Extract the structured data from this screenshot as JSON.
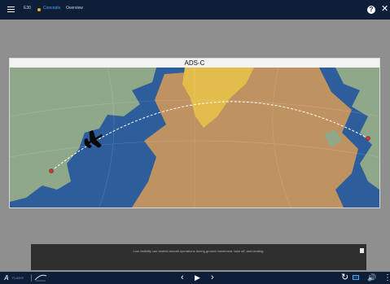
{
  "header": {
    "menu_icon": "hamburger-menu-icon",
    "crumb_code": "E30",
    "crumb_section": "Concepts",
    "crumb_page": "Overview",
    "help_glyph": "?",
    "close_glyph": "✕",
    "colors": {
      "bar": "#0f1e38",
      "accent": "#4aa7f0",
      "dot": "#f2b01e"
    }
  },
  "slide": {
    "title": "ADS-C",
    "map_icons": [
      "airplane-icon",
      "origin-point-icon",
      "destination-point-icon"
    ],
    "colors": {
      "water": "#2d5d9a",
      "land": "#8fa88a",
      "airspace": "#c7955e",
      "ice": "#e2bd4c",
      "route": "#ffffff",
      "point": "#c43b3b"
    }
  },
  "caption": {
    "text": "Low visibility can restrict aircraft operations during ground movement, take off, and landing.",
    "note_icon": "notes-icon"
  },
  "footer": {
    "logo_mark": "A",
    "logo_text": "FLIGHT",
    "prev_glyph": "‹",
    "play_glyph": "▶",
    "next_glyph": "›",
    "replay_glyph": "↻",
    "cc_label": "CC",
    "volume_glyph": "🔊",
    "more_glyph": "⋮"
  }
}
